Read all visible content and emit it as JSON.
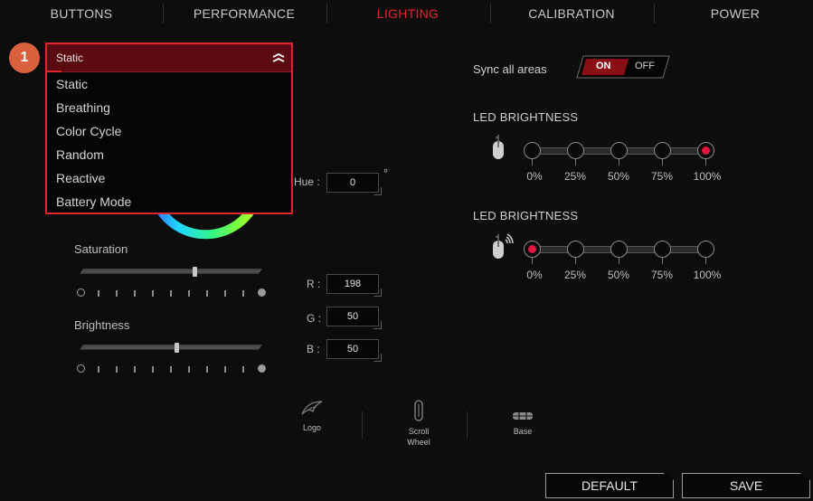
{
  "tabs": [
    {
      "label": "BUTTONS",
      "active": false
    },
    {
      "label": "PERFORMANCE",
      "active": false
    },
    {
      "label": "LIGHTING",
      "active": true
    },
    {
      "label": "CALIBRATION",
      "active": false
    },
    {
      "label": "POWER",
      "active": false
    }
  ],
  "effect_dropdown": {
    "step_number": "1",
    "selected": "Static",
    "options": [
      "Static",
      "Breathing",
      "Color Cycle",
      "Random",
      "Reactive",
      "Battery Mode"
    ]
  },
  "color": {
    "hue_label": "Hue :",
    "hue_value": "0",
    "hue_unit": "°",
    "saturation_label": "Saturation",
    "saturation_level": 0.63,
    "brightness_label": "Brightness",
    "brightness_level": 0.53,
    "r_label": "R :",
    "r_value": "198",
    "g_label": "G :",
    "g_value": "50",
    "b_label": "B :",
    "b_value": "50"
  },
  "sync": {
    "label": "Sync all areas",
    "on_label": "ON",
    "off_label": "OFF",
    "state": "ON"
  },
  "led_brightness_mouse": {
    "title": "LED BRIGHTNESS",
    "icon": "mouse-icon",
    "levels": [
      "0%",
      "25%",
      "50%",
      "75%",
      "100%"
    ],
    "selected": "100%"
  },
  "led_brightness_wireless": {
    "title": "LED BRIGHTNESS",
    "icon": "wireless-mouse-icon",
    "levels": [
      "0%",
      "25%",
      "50%",
      "75%",
      "100%"
    ],
    "selected": "0%"
  },
  "areas": [
    {
      "label": "Logo",
      "icon": "rog-logo-icon"
    },
    {
      "label": "Scroll\nWheel",
      "icon": "scroll-wheel-icon"
    },
    {
      "label": "Base",
      "icon": "base-icon"
    }
  ],
  "footer": {
    "default_label": "DEFAULT",
    "save_label": "SAVE"
  },
  "colors": {
    "accent_red": "#e0262c",
    "led_on": "#e3163f",
    "step_badge": "#d9603d"
  }
}
